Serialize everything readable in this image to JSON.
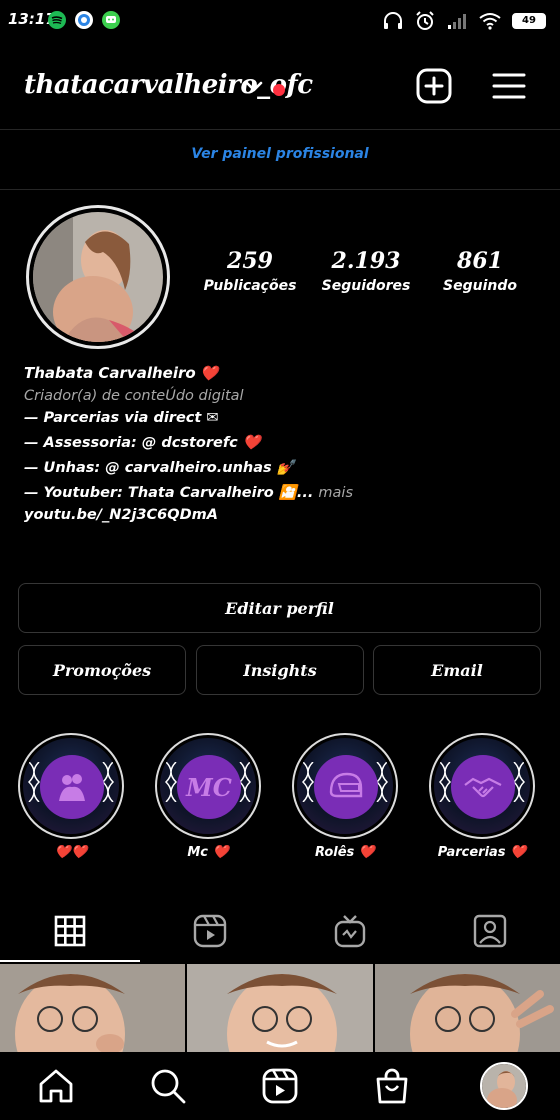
{
  "status_bar": {
    "time": "13:17",
    "battery": "49",
    "app_icons": [
      "spotify-icon",
      "browser-icon",
      "messages-icon"
    ]
  },
  "header": {
    "username": "thatacarvalheiro_ofc"
  },
  "professional_dashboard": "Ver painel profissional",
  "stats": {
    "posts_count": "259",
    "posts_label": "Publicações",
    "followers_count": "2.193",
    "followers_label": "Seguidores",
    "following_count": "861",
    "following_label": "Seguindo"
  },
  "bio": {
    "name": "Thabata Carvalheiro",
    "category": "Criador(a) de conteÚdo digital",
    "lines": [
      "— Parcerias via direct ✉",
      "— Assessoria: @ dcstorefc",
      "— Unhas: @ carvalheiro.unhas 💅",
      "— Youtuber: Thata Carvalheiro 🎦..."
    ],
    "more": "mais",
    "link": "youtu.be/_N2j3C6QDmA"
  },
  "buttons": {
    "edit_profile": "Editar perfil",
    "promotions": "Promoções",
    "insights": "Insights",
    "email": "Email"
  },
  "highlights": [
    {
      "label": "",
      "icon": "couple-icon"
    },
    {
      "label": "Mc",
      "icon": "mc-text",
      "text": "MC"
    },
    {
      "label": "Rolês",
      "icon": "helmet-icon"
    },
    {
      "label": "Parcerias",
      "icon": "handshake-icon"
    }
  ],
  "colors": {
    "link_blue": "#2b84e4",
    "heart_red": "#ff2b3a",
    "highlight_purple": "#7a2db6",
    "live_dot": "#ff3040"
  },
  "tabs": [
    "grid-icon",
    "reels-icon",
    "igtv-icon",
    "tagged-icon"
  ],
  "bottom_nav": [
    "home-icon",
    "search-icon",
    "reels-icon",
    "shop-icon",
    "profile-avatar"
  ]
}
